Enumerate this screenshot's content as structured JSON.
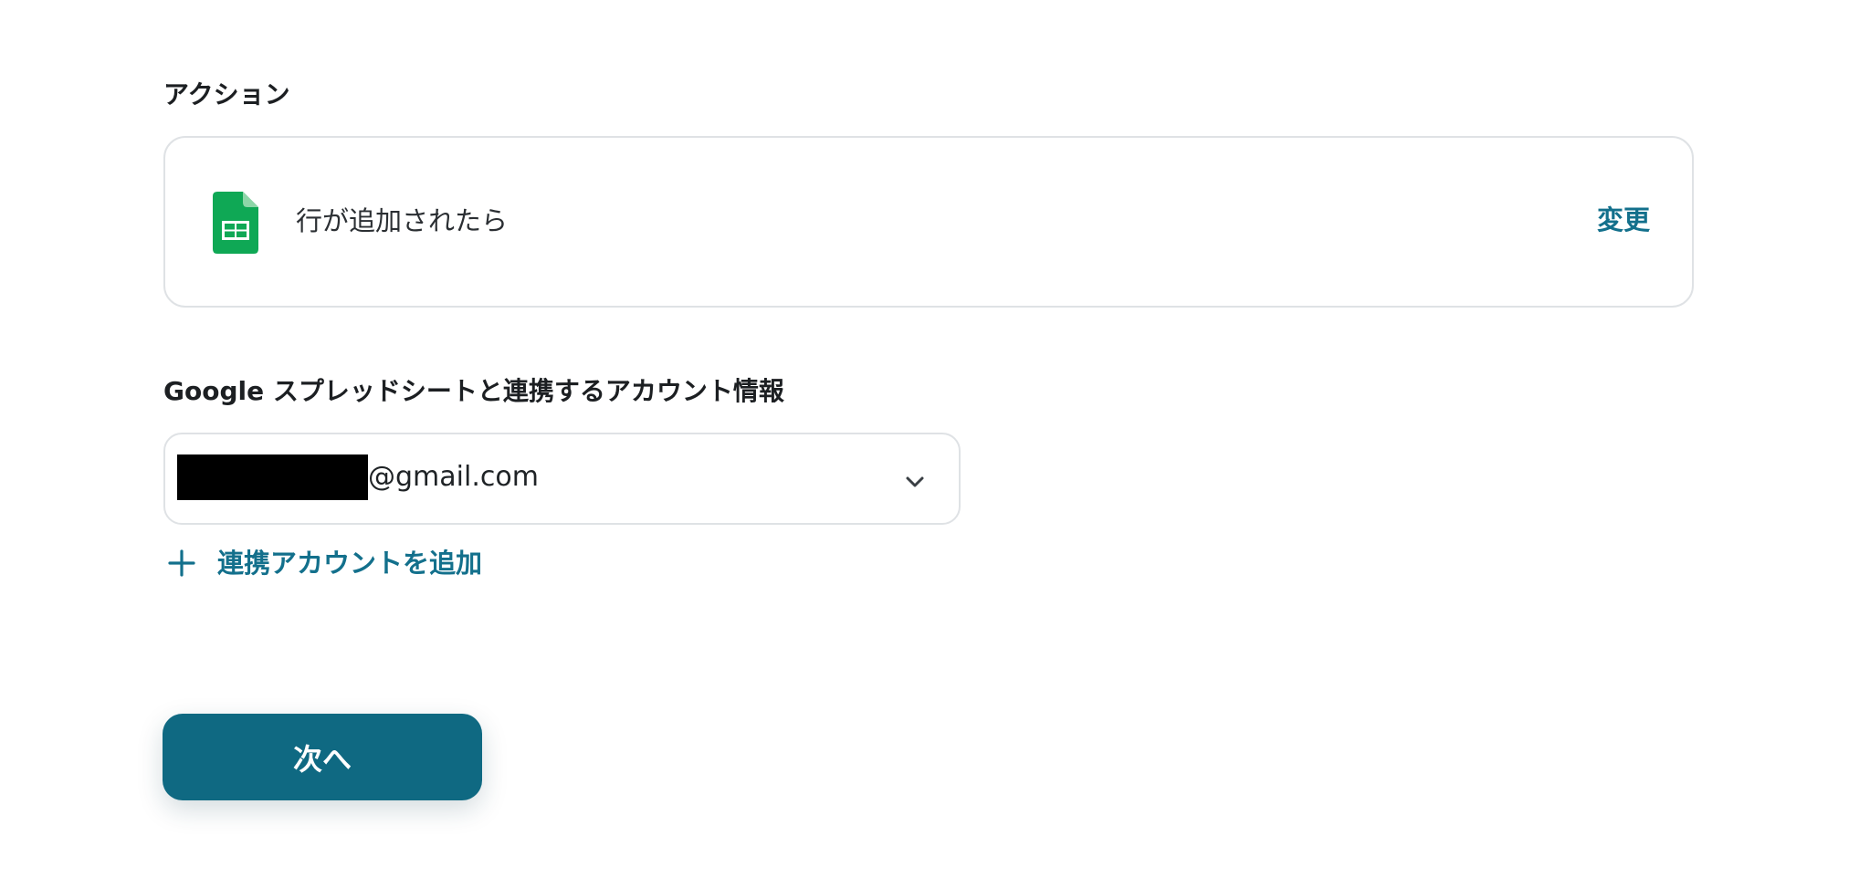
{
  "action_section": {
    "label": "アクション",
    "card": {
      "app_icon": "google-sheets-icon",
      "trigger_text": "行が追加されたら",
      "change_label": "変更"
    }
  },
  "account_section": {
    "label": "Google スプレッドシートと連携するアカウント情報",
    "select": {
      "value_domain": "@gmail.com",
      "redacted": true,
      "dropdown_icon": "chevron-down-icon"
    },
    "add_account": {
      "icon": "plus-icon",
      "label": "連携アカウントを追加"
    }
  },
  "footer": {
    "next_label": "次へ"
  },
  "colors": {
    "accent": "#13708c",
    "button_bg": "#0f6982",
    "sheets_green": "#0fa855",
    "border": "#dfe2e5"
  }
}
